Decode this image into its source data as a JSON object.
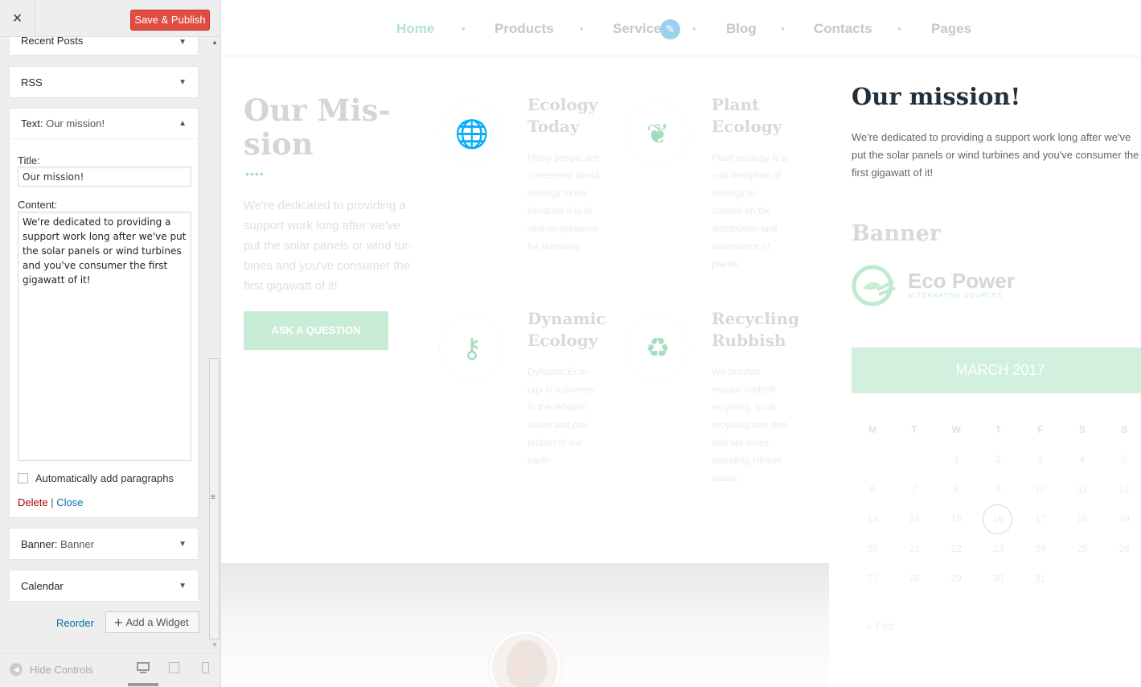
{
  "panel": {
    "close_icon_glyph": "×",
    "save_label": "Save & Publish",
    "widgets": {
      "recent_posts": "Recent Posts",
      "rss": "RSS",
      "text": {
        "type": "Text:",
        "name": "Our mission!"
      },
      "banner": {
        "type": "Banner:",
        "name": "Banner"
      },
      "calendar": "Calendar"
    },
    "form": {
      "title_label": "Title:",
      "title_value": "Our mission!",
      "content_label": "Content:",
      "content_value": "We're dedicated to providing a support work long after we've put the solar panels or wind turbines and you've consumer the first gigawatt of it!",
      "autop_label": "Automatically add paragraphs",
      "autop_checked": false,
      "delete_label": "Delete",
      "separator": "|",
      "close_label": "Close"
    },
    "reorder_label": "Reorder",
    "add_widget_label": "Add a Widget",
    "hide_controls_label": "Hide Controls",
    "active_device": "desktop",
    "colors": {
      "save": "#e14d43",
      "link": "#0073aa",
      "delete": "#aa0000"
    }
  },
  "nav": {
    "items": [
      "Home",
      "Products",
      "Service",
      "Blog",
      "Contacts",
      "Pages"
    ],
    "active": "Home",
    "edit_icon": "pencil-icon"
  },
  "mission": {
    "heading": "Our Mis-sion",
    "dots": "••••",
    "text": "We're dedicated to providing a support work long after we've put the solar panels or wind tur-bines and you've consumer the first gigawatt of it!",
    "button_label": "ASK A QUESTION"
  },
  "features": [
    {
      "title": "Ecology Today",
      "text": "Many people are concerned about ecology today because it is of vital im-portance for humanity.",
      "icon": "globe-icon"
    },
    {
      "title": "Plant Ecology",
      "text": "Plant ecology is a sub-discipline of ecology fo-cussed on the distribution and abundance of plants.",
      "icon": "leaf-icon"
    },
    {
      "title": "Dynamic Ecology",
      "text": "Dynamic Ecol-ogy is a pioneer in the rehabili-tation and pro-tection of our earth.",
      "icon": "bulb-icon"
    },
    {
      "title": "Recycling Rubbish",
      "text": "We provide regular rubbish recycling, local recycling cen-tres and ser-vices including clinical waste.",
      "icon": "recycle-bin-icon"
    }
  ],
  "sidebar": {
    "mission_title": "Our mission!",
    "mission_text": "We're dedicated to providing a support work long after we've put the solar panels or wind turbines and you've consumer the first gigawatt of it!",
    "banner_title": "Banner",
    "logo_name": "Eco Power",
    "logo_sub": "ALTERNATIVE SOURCES",
    "calendar": {
      "month": "MARCH 2017",
      "dow": [
        "M",
        "T",
        "W",
        "T",
        "F",
        "S",
        "S"
      ],
      "weeks": [
        [
          "",
          "",
          "1",
          "2",
          "3",
          "4",
          "5"
        ],
        [
          "6",
          "7",
          "8",
          "9",
          "10",
          "11",
          "12"
        ],
        [
          "13",
          "14",
          "15",
          "16",
          "17",
          "18",
          "19"
        ],
        [
          "20",
          "21",
          "22",
          "23",
          "24",
          "25",
          "26"
        ],
        [
          "27",
          "28",
          "29",
          "30",
          "31",
          "",
          ""
        ]
      ],
      "today": "16",
      "prev_label": "« Feb"
    }
  },
  "accent": "#a5dcbd"
}
